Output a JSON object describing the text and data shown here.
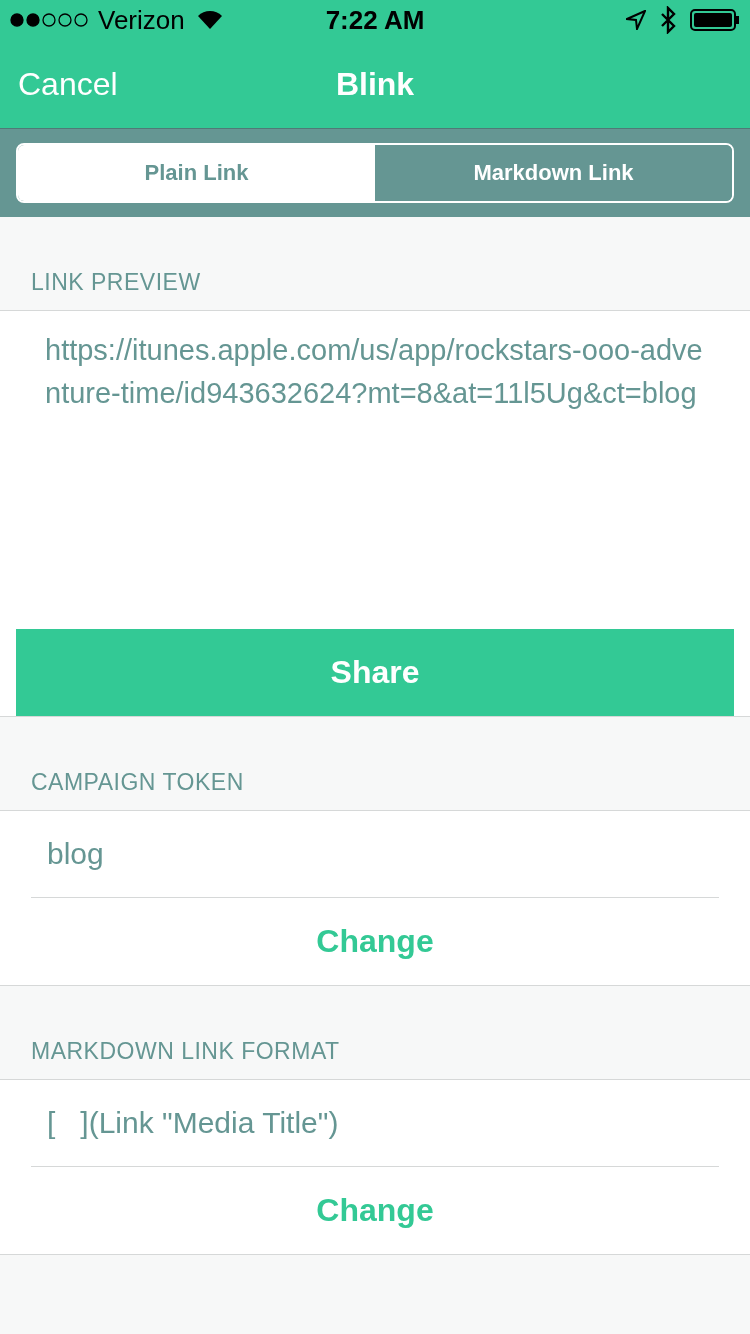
{
  "status_bar": {
    "carrier": "Verizon",
    "time": "7:22 AM"
  },
  "nav": {
    "cancel": "Cancel",
    "title": "Blink"
  },
  "segments": [
    {
      "label": "Plain Link",
      "selected": true
    },
    {
      "label": "Markdown Link",
      "selected": false
    }
  ],
  "link_preview": {
    "header": "LINK PREVIEW",
    "text": "https://itunes.apple.com/us/app/rockstars-ooo-adventure-time/id943632624?mt=8&at=11l5Ug&ct=blog",
    "button": "Share"
  },
  "sections": [
    {
      "header": "CAMPAIGN TOKEN",
      "value": "blog",
      "button": "Change"
    },
    {
      "header": "MARKDOWN LINK FORMAT",
      "value": "[   ](Link \"Media Title\")",
      "button": "Change"
    }
  ]
}
